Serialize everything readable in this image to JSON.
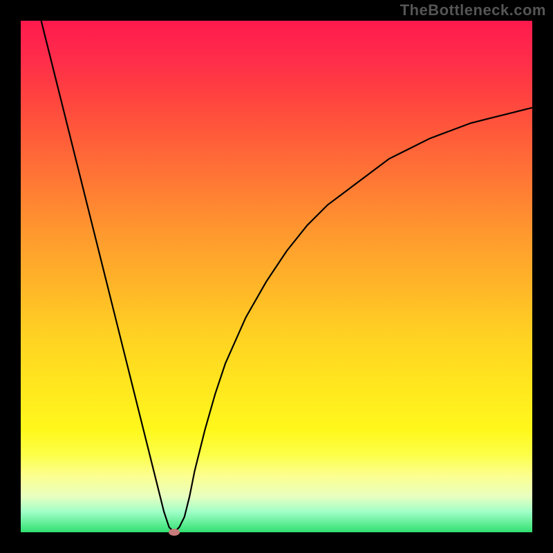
{
  "watermark": "TheBottleneck.com",
  "chart_data": {
    "type": "line",
    "title": "",
    "xlabel": "",
    "ylabel": "",
    "xlim": [
      0,
      100
    ],
    "ylim": [
      0,
      100
    ],
    "x": [
      4,
      6,
      8,
      10,
      12,
      14,
      16,
      18,
      20,
      22,
      24,
      26,
      28,
      29,
      30,
      31,
      32,
      33,
      34,
      36,
      38,
      40,
      44,
      48,
      52,
      56,
      60,
      64,
      68,
      72,
      76,
      80,
      84,
      88,
      92,
      96,
      100
    ],
    "y": [
      100,
      92,
      84,
      76,
      68,
      60,
      52,
      44,
      36,
      28,
      20,
      12,
      4,
      1,
      0,
      1,
      3,
      7,
      12,
      20,
      27,
      33,
      42,
      49,
      55,
      60,
      64,
      67,
      70,
      73,
      75,
      77,
      78.5,
      80,
      81,
      82,
      83
    ],
    "marker": {
      "x": 30,
      "y": 0
    },
    "background_gradient": {
      "type": "vertical",
      "stops": [
        {
          "pos": 0.0,
          "color": "#ff1a4d"
        },
        {
          "pos": 0.5,
          "color": "#ffb628"
        },
        {
          "pos": 0.8,
          "color": "#fff81c"
        },
        {
          "pos": 1.0,
          "color": "#30e070"
        }
      ]
    }
  },
  "colors": {
    "frame": "#000000",
    "curve": "#000000",
    "marker": "#c77b7b"
  }
}
